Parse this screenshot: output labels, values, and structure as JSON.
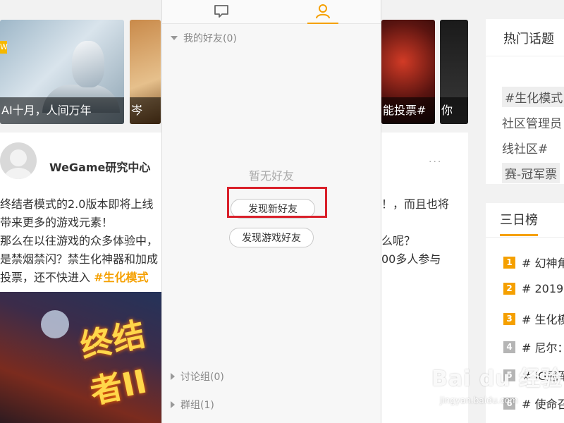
{
  "banners": {
    "tag": "W",
    "caption_1": "AI十月，人间万年",
    "caption_2": "岑",
    "caption_3": "能投票#",
    "caption_4": "你"
  },
  "post": {
    "author": "WeGame研究中心",
    "more": "···",
    "line_1": "终结者模式的2.0版本即将上线",
    "line_1_right": "！，而且也将",
    "line_2": "带来更多的游戏元素！",
    "line_3": "那么在以往游戏的众多体验中，",
    "line_3_right": "么呢？",
    "line_4": "是禁烟禁闪？禁生化神器和加成",
    "line_4_right": "00多人参与",
    "line_5": "投票，还不快进入",
    "line_5_hashtag": "#生化模式",
    "image_title": "终结者II"
  },
  "friends_panel": {
    "my_friends": "我的好友(0)",
    "empty": "暂无好友",
    "find_new_friends": "发现新好友",
    "find_game_friends": "发现游戏好友",
    "discussion_groups": "讨论组(0)",
    "groups": "群组(1)"
  },
  "hot_topics": {
    "title": "热门话题",
    "chip_1": "#生化模式",
    "text_2": "社区管理员",
    "text_3": "线社区#",
    "chip_4": "赛-冠军票"
  },
  "three_day_rank": {
    "title": "三日榜",
    "items": [
      {
        "num": "1",
        "text": "# 幻神角"
      },
      {
        "num": "2",
        "text": "# 2019L"
      },
      {
        "num": "3",
        "text": "# 生化模"
      },
      {
        "num": "4",
        "text": "# 尼尔："
      },
      {
        "num": "5",
        "text": "# iG冠军"
      },
      {
        "num": "6",
        "text": "# 使命召"
      }
    ]
  },
  "watermark": {
    "brand": "Bai du 经验",
    "url": "jingyan.baidu.com"
  },
  "colors": {
    "accent": "#f5a000",
    "highlight_box": "#d9202a"
  }
}
